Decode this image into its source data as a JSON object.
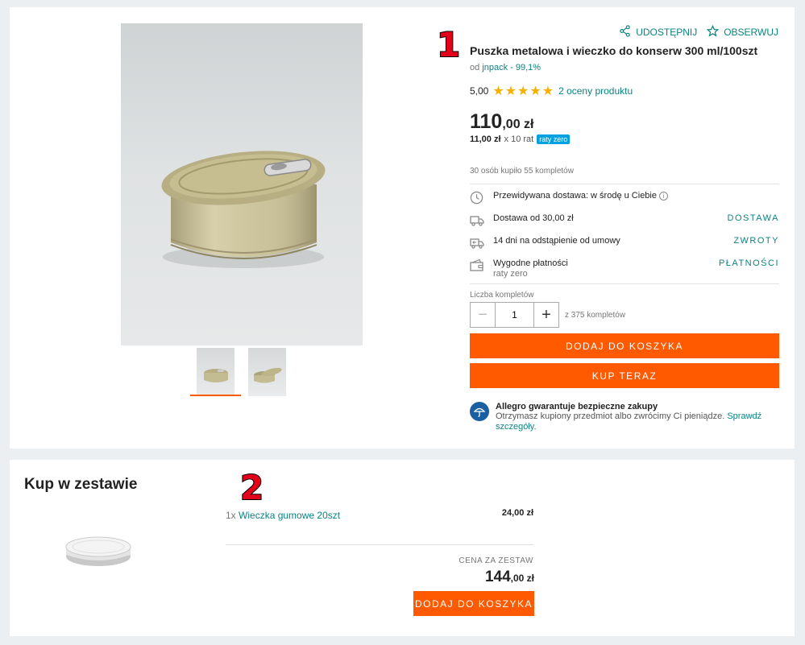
{
  "annotations": {
    "one": "1",
    "two": "2"
  },
  "actions": {
    "share": "UDOSTĘPNIJ",
    "watch": "OBSERWUJ"
  },
  "product": {
    "title": "Puszka metalowa i wieczko do konserw 300 ml/100szt",
    "seller_prefix": "od",
    "seller_name": "jnpack - 99,1%",
    "rating_value": "5,00",
    "stars": "★★★★★",
    "rating_count": "2 oceny produktu",
    "price_main": "110",
    "price_fraction": ",00 zł",
    "installment_amount": "11,00 zł",
    "installment_count": "x 10 rat",
    "installment_badge": "raty zero",
    "bought": "30 osób kupiło 55 kompletów"
  },
  "info_rows": [
    {
      "icon": "clock-icon",
      "text": "Przewidywana dostawa: w środę u Ciebie",
      "sub": "",
      "link": ""
    },
    {
      "icon": "truck-icon",
      "text": "Dostawa od 30,00 zł",
      "sub": "",
      "link": "DOSTAWA"
    },
    {
      "icon": "return-truck-icon",
      "text": "14 dni na odstąpienie od umowy",
      "sub": "",
      "link": "ZWROTY"
    },
    {
      "icon": "wallet-icon",
      "text": "Wygodne płatności",
      "sub": "raty zero",
      "link": "PŁATNOŚCI"
    }
  ],
  "quantity": {
    "label": "Liczba kompletów",
    "value": "1",
    "of_text": "z 375 kompletów"
  },
  "buttons": {
    "add_to_cart": "DODAJ DO KOSZYKA",
    "buy_now": "KUP TERAZ"
  },
  "guarantee": {
    "title": "Allegro gwarantuje bezpieczne zakupy",
    "desc": "Otrzymasz kupiony przedmiot albo zwrócimy Ci pieniądze.",
    "link": "Sprawdź szczegóły",
    "end": "."
  },
  "bundle": {
    "title": "Kup w zestawie",
    "item_qty": "1x",
    "item_name": "Wieczka gumowe 20szt",
    "item_price": "24,00 zł",
    "set_label": "CENA ZA ZESTAW",
    "set_price_main": "144",
    "set_price_fraction": ",00 zł",
    "add_to_cart": "DODAJ DO KOSZYKA"
  },
  "colors": {
    "accent": "#ff5a00",
    "link": "#0b8380",
    "star": "#f6b100",
    "badge": "#00a0e1"
  }
}
